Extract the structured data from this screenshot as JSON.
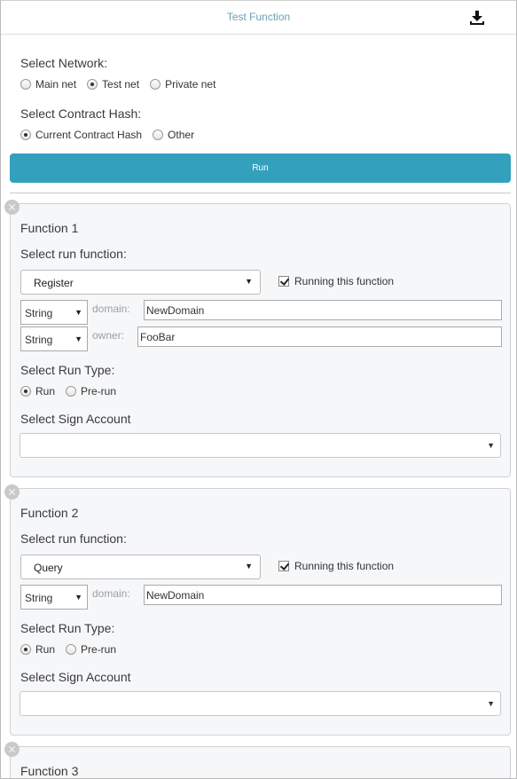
{
  "header": {
    "title": "Test Function",
    "download_icon": "download-icon"
  },
  "network": {
    "label": "Select Network:",
    "options": [
      {
        "label": "Main net",
        "checked": false
      },
      {
        "label": "Test net",
        "checked": true
      },
      {
        "label": "Private net",
        "checked": false
      }
    ]
  },
  "contract": {
    "label": "Select Contract Hash:",
    "options": [
      {
        "label": "Current Contract Hash",
        "checked": true
      },
      {
        "label": "Other",
        "checked": false
      }
    ]
  },
  "run_button": {
    "label": "Run",
    "color": "#33a0bd"
  },
  "functions": [
    {
      "title": "Function 1",
      "run_function_label": "Select run function:",
      "selected_function": "Register",
      "running_label": "Running this function",
      "running_checked": true,
      "params": [
        {
          "type": "String",
          "name": "domain:",
          "value": "NewDomain"
        },
        {
          "type": "String",
          "name": "owner:",
          "value": "FooBar"
        }
      ],
      "run_type_label": "Select Run Type:",
      "run_type_options": [
        {
          "label": "Run",
          "checked": true
        },
        {
          "label": "Pre-run",
          "checked": false
        }
      ],
      "sign_account_label": "Select Sign Account",
      "sign_account_value": ""
    },
    {
      "title": "Function 2",
      "run_function_label": "Select run function:",
      "selected_function": "Query",
      "running_label": "Running this function",
      "running_checked": true,
      "params": [
        {
          "type": "String",
          "name": "domain:",
          "value": "NewDomain"
        }
      ],
      "run_type_label": "Select Run Type:",
      "run_type_options": [
        {
          "label": "Run",
          "checked": true
        },
        {
          "label": "Pre-run",
          "checked": false
        }
      ],
      "sign_account_label": "Select Sign Account",
      "sign_account_value": ""
    },
    {
      "title": "Function 3"
    }
  ]
}
